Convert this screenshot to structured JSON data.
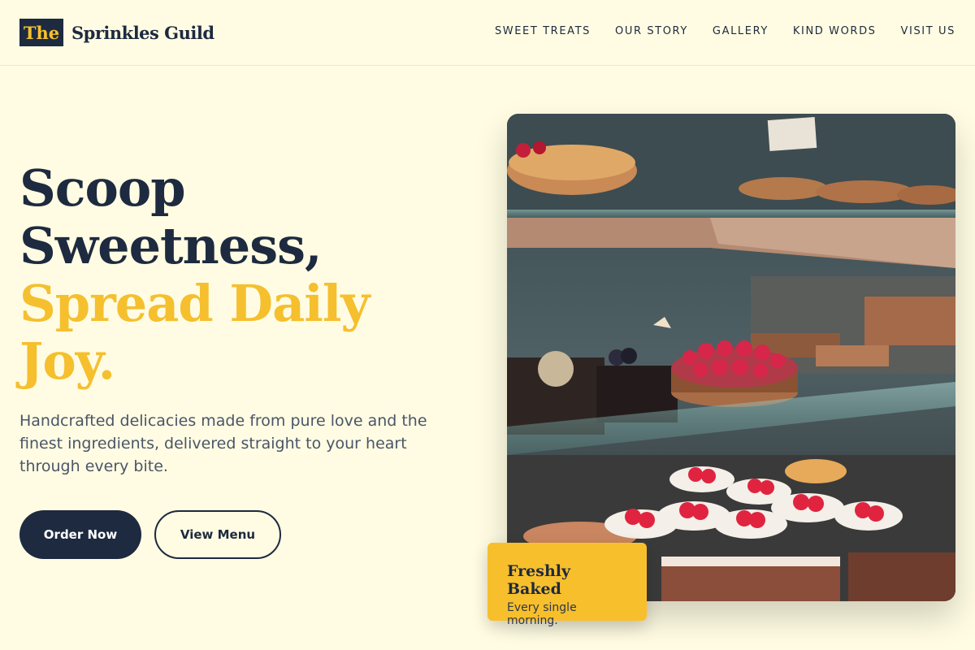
{
  "brand": {
    "mark": "The",
    "name": "Sprinkles Guild"
  },
  "nav": [
    "SWEET TREATS",
    "OUR STORY",
    "GALLERY",
    "KIND WORDS",
    "VISIT US"
  ],
  "hero": {
    "title_dark": [
      "Scoop",
      "Sweetness,"
    ],
    "title_accent": [
      "Spread Daily",
      "Joy."
    ],
    "subtitle": "Handcrafted delicacies made from pure love and the finest ingredients, delivered straight to your heart through every bite.",
    "primary_button": "Order Now",
    "secondary_button": "View Menu"
  },
  "badge": {
    "title": "Freshly Baked",
    "subtitle": "Every single morning."
  },
  "colors": {
    "navy": "#1d2a3f",
    "accent": "#f5bf2e",
    "background": "#fffce3"
  }
}
